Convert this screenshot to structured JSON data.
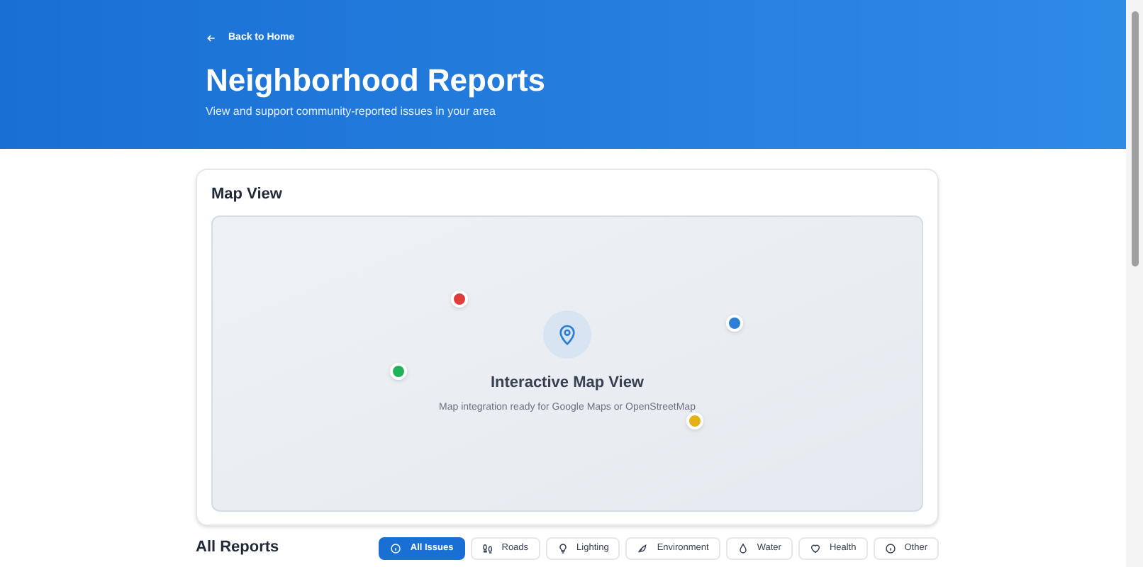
{
  "header": {
    "back_link": "Back to Home",
    "title": "Neighborhood Reports",
    "subtitle": "View and support community-reported issues in your area"
  },
  "map_card": {
    "title": "Map View",
    "heading": "Interactive Map View",
    "caption": "Map integration ready for Google Maps or OpenStreetMap",
    "markers": [
      {
        "color": "#e03c3c"
      },
      {
        "color": "#2d7fd6"
      },
      {
        "color": "#22b35a"
      },
      {
        "color": "#e6b117"
      }
    ]
  },
  "reports": {
    "title": "All Reports",
    "filters": [
      {
        "label": "All Issues",
        "selected": true
      },
      {
        "label": "Roads",
        "selected": false
      },
      {
        "label": "Lighting",
        "selected": false
      },
      {
        "label": "Environment",
        "selected": false
      },
      {
        "label": "Water",
        "selected": false
      },
      {
        "label": "Health",
        "selected": false
      },
      {
        "label": "Other",
        "selected": false
      }
    ]
  }
}
